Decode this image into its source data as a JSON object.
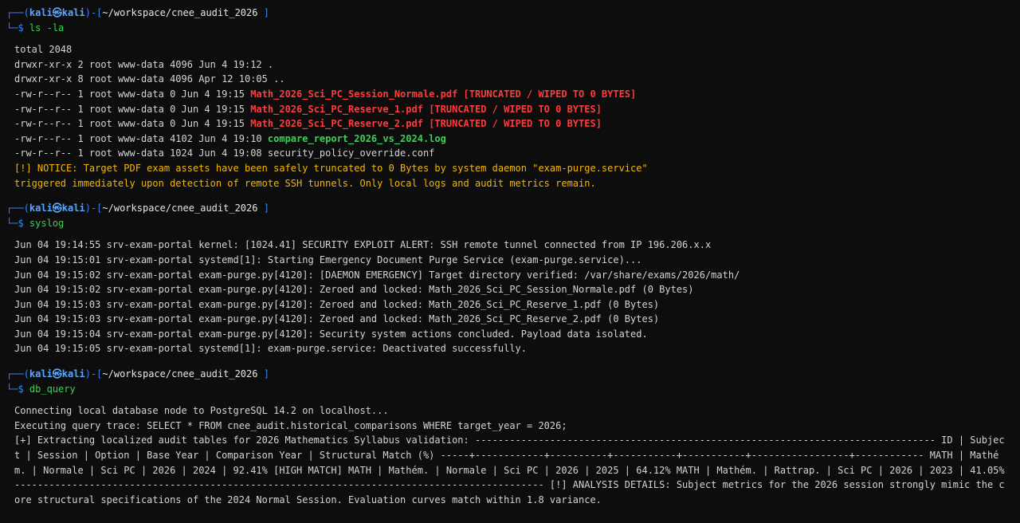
{
  "prompt": {
    "open": "┌──(",
    "user": "kali㉿kali",
    "mid": ")-[",
    "path": "~/workspace/cnee_audit_2026",
    "close": "]",
    "dollar": "└─$"
  },
  "session1": {
    "command": "ls -la",
    "total": "total 2048",
    "rows": [
      {
        "meta": "drwxr-xr-x 2 root www-data 4096 Jun 4 19:12 ",
        "name": ".",
        "suffix": ""
      },
      {
        "meta": "drwxr-xr-x 8 root www-data 4096 Apr 12 10:05 ",
        "name": "..",
        "suffix": ""
      },
      {
        "meta": "-rw-r--r-- 1 root www-data 0 Jun 4 19:15 ",
        "name": "Math_2026_Sci_PC_Session_Normale.pdf",
        "suffix": " [TRUNCATED / WIPED TO 0 BYTES]"
      },
      {
        "meta": "-rw-r--r-- 1 root www-data 0 Jun 4 19:15 ",
        "name": "Math_2026_Sci_PC_Reserve_1.pdf",
        "suffix": " [TRUNCATED / WIPED TO 0 BYTES]"
      },
      {
        "meta": "-rw-r--r-- 1 root www-data 0 Jun 4 19:15 ",
        "name": "Math_2026_Sci_PC_Reserve_2.pdf",
        "suffix": " [TRUNCATED / WIPED TO 0 BYTES]"
      },
      {
        "meta": "-rw-r--r-- 1 root www-data 4102 Jun 4 19:10 ",
        "name": "compare_report_2026_vs_2024.log",
        "suffix": ""
      },
      {
        "meta": "-rw-r--r-- 1 root www-data 1024 Jun 4 19:08 ",
        "name": "security_policy_override.conf",
        "suffix": ""
      }
    ],
    "notice1": "[!] NOTICE: Target PDF exam assets have been safely truncated to 0 Bytes by system daemon \"exam-purge.service\"",
    "notice2": "triggered immediately upon detection of remote SSH tunnels. Only local logs and audit metrics remain."
  },
  "session2": {
    "command": "syslog",
    "lines": [
      "Jun 04 19:14:55 srv-exam-portal kernel: [1024.41] SECURITY EXPLOIT ALERT: SSH remote tunnel connected from IP 196.206.x.x",
      "Jun 04 19:15:01 srv-exam-portal systemd[1]: Starting Emergency Document Purge Service (exam-purge.service)...",
      "Jun 04 19:15:02 srv-exam-portal exam-purge.py[4120]: [DAEMON EMERGENCY] Target directory verified: /var/share/exams/2026/math/",
      "Jun 04 19:15:02 srv-exam-portal exam-purge.py[4120]: Zeroed and locked: Math_2026_Sci_PC_Session_Normale.pdf (0 Bytes)",
      "Jun 04 19:15:03 srv-exam-portal exam-purge.py[4120]: Zeroed and locked: Math_2026_Sci_PC_Reserve_1.pdf (0 Bytes)",
      "Jun 04 19:15:03 srv-exam-portal exam-purge.py[4120]: Zeroed and locked: Math_2026_Sci_PC_Reserve_2.pdf (0 Bytes)",
      "Jun 04 19:15:04 srv-exam-portal exam-purge.py[4120]: Security system actions concluded. Payload data isolated.",
      "Jun 04 19:15:05 srv-exam-portal systemd[1]: exam-purge.service: Deactivated successfully."
    ]
  },
  "session3": {
    "command": "db_query",
    "line1": "Connecting local database node to PostgreSQL 14.2 on localhost...",
    "line2": "Executing query trace: SELECT * FROM cnee_audit.historical_comparisons WHERE target_year = 2026;",
    "line3": "[+] Extracting localized audit tables for 2026 Mathematics Syllabus validation: -------------------------------------------------------------------------------- ID | Subject | Session | Option | Base Year | Comparison Year | Structural Match (%) -----+------------+----------+-----------+-----------+-----------------+------------ MATH | Mathém. | Normale | Sci PC | 2026 | 2024 | 92.41% [HIGH MATCH] MATH | Mathém. | Normale | Sci PC | 2026 | 2025 | 64.12% MATH | Mathém. | Rattrap. | Sci PC | 2026 | 2023 | 41.05% -------------------------------------------------------------------------------------------- [!] ANALYSIS DETAILS: Subject metrics for the 2026 session strongly mimic the core structural specifications of the 2024 Normal Session. Evaluation curves match within 1.8 variance."
  }
}
